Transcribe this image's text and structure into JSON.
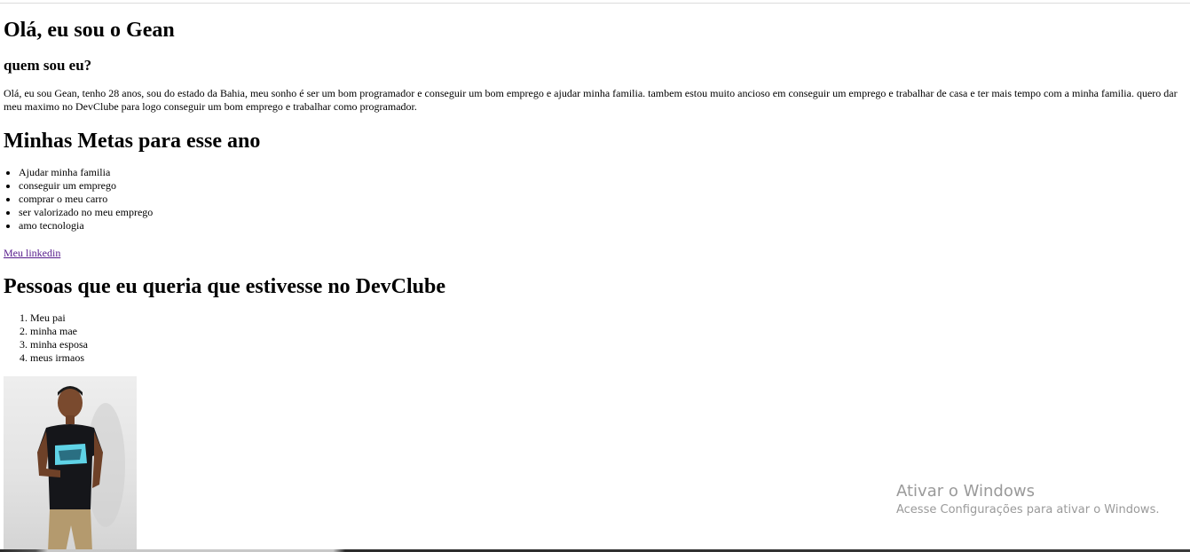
{
  "heading": "Olá, eu sou o Gean",
  "subheading": "quem sou eu?",
  "bio": "Olá, eu sou Gean, tenho 28 anos, sou do estado da Bahia, meu sonho é ser um bom programador e conseguir um bom emprego e ajudar minha familia. tambem estou muito ancioso em conseguir um emprego e trabalhar de casa e ter mais tempo com a minha familia. quero dar meu maximo no DevClube para logo conseguir um bom emprego e trabalhar como programador.",
  "goals": {
    "title": "Minhas Metas para esse ano",
    "items": [
      "Ajudar minha familia",
      "conseguir um emprego",
      "comprar o meu carro",
      "ser valorizado no meu emprego",
      "amo tecnologia"
    ]
  },
  "link": "Meu linkedin",
  "people": {
    "title": "Pessoas que eu queria que estivesse no DevClube",
    "items": [
      "Meu pai",
      "minha mae",
      "minha esposa",
      "meus irmaos"
    ]
  },
  "watermark": {
    "title": "Ativar o Windows",
    "subtitle": "Acesse Configurações para ativar o Windows."
  }
}
